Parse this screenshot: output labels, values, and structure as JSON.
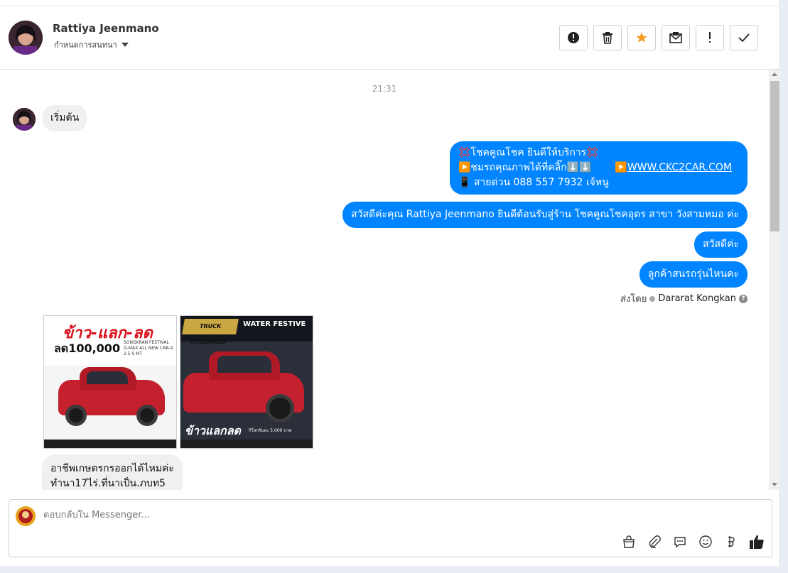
{
  "header": {
    "name": "Rattiya Jeenmano",
    "status": "กำหนดการสนทนา"
  },
  "actions": [
    {
      "name": "mark-spam-icon"
    },
    {
      "name": "trash-icon"
    },
    {
      "name": "star-icon"
    },
    {
      "name": "mark-unread-icon"
    },
    {
      "name": "important-icon"
    },
    {
      "name": "done-check-icon"
    }
  ],
  "thread": {
    "timestamp": "21:31",
    "start_msg": "เริ่มต้น",
    "out1": {
      "line1": "💢โชคคูณโชค ยินดีให้บริการ💢",
      "line2a": "▶️ชมรถคุณภาพได้ที่คลิ๊ก⬇️⬇️",
      "line2b": "▶️",
      "link": "WWW.CKC2CAR.COM",
      "line3": "📱 สายด่วน 088 557 7932 เจ้หนู"
    },
    "out2": "สวัสดีค่ะคุณ Rattiya Jeenmano ยินดีต้อนรับสู่ร้าน โชคคูณโชคอุดร สาขา วังสามหมอ ค่ะ",
    "out3": "สวัสดีค่ะ",
    "out4": "ลูกค้าสนรถรุ่นไหนคะ",
    "sent_by_label": "ส่งโดย",
    "sent_by_agent": "Dararat Kongkan",
    "help_mark": "?",
    "img1": {
      "title": "ข้าว-แลก-ลด",
      "discount": "ลด100,000",
      "subtitle": "SONGKRAN FESTIVAL D-MAX ALL NEW CAB-4 2.5 S MT"
    },
    "img2": {
      "badge": "TRUCK COLORADO",
      "title": "WATER FESTIVE",
      "bigtext": "ข้าวแลกลด",
      "small": "กิโลกรัมละ 5,000 บาท"
    },
    "in_last_line1": "อาชีพเกษตรกรออกได้ไหมค่ะ",
    "in_last_line2": "ทำนา17ไร่.ที่นาเป็น.ภบท5"
  },
  "composer": {
    "placeholder": "ตอบกลับใน Messenger...",
    "tools": [
      "shop-icon",
      "attach-icon",
      "saved-reply-icon",
      "emoji-icon",
      "baht-icon",
      "like-icon"
    ]
  }
}
